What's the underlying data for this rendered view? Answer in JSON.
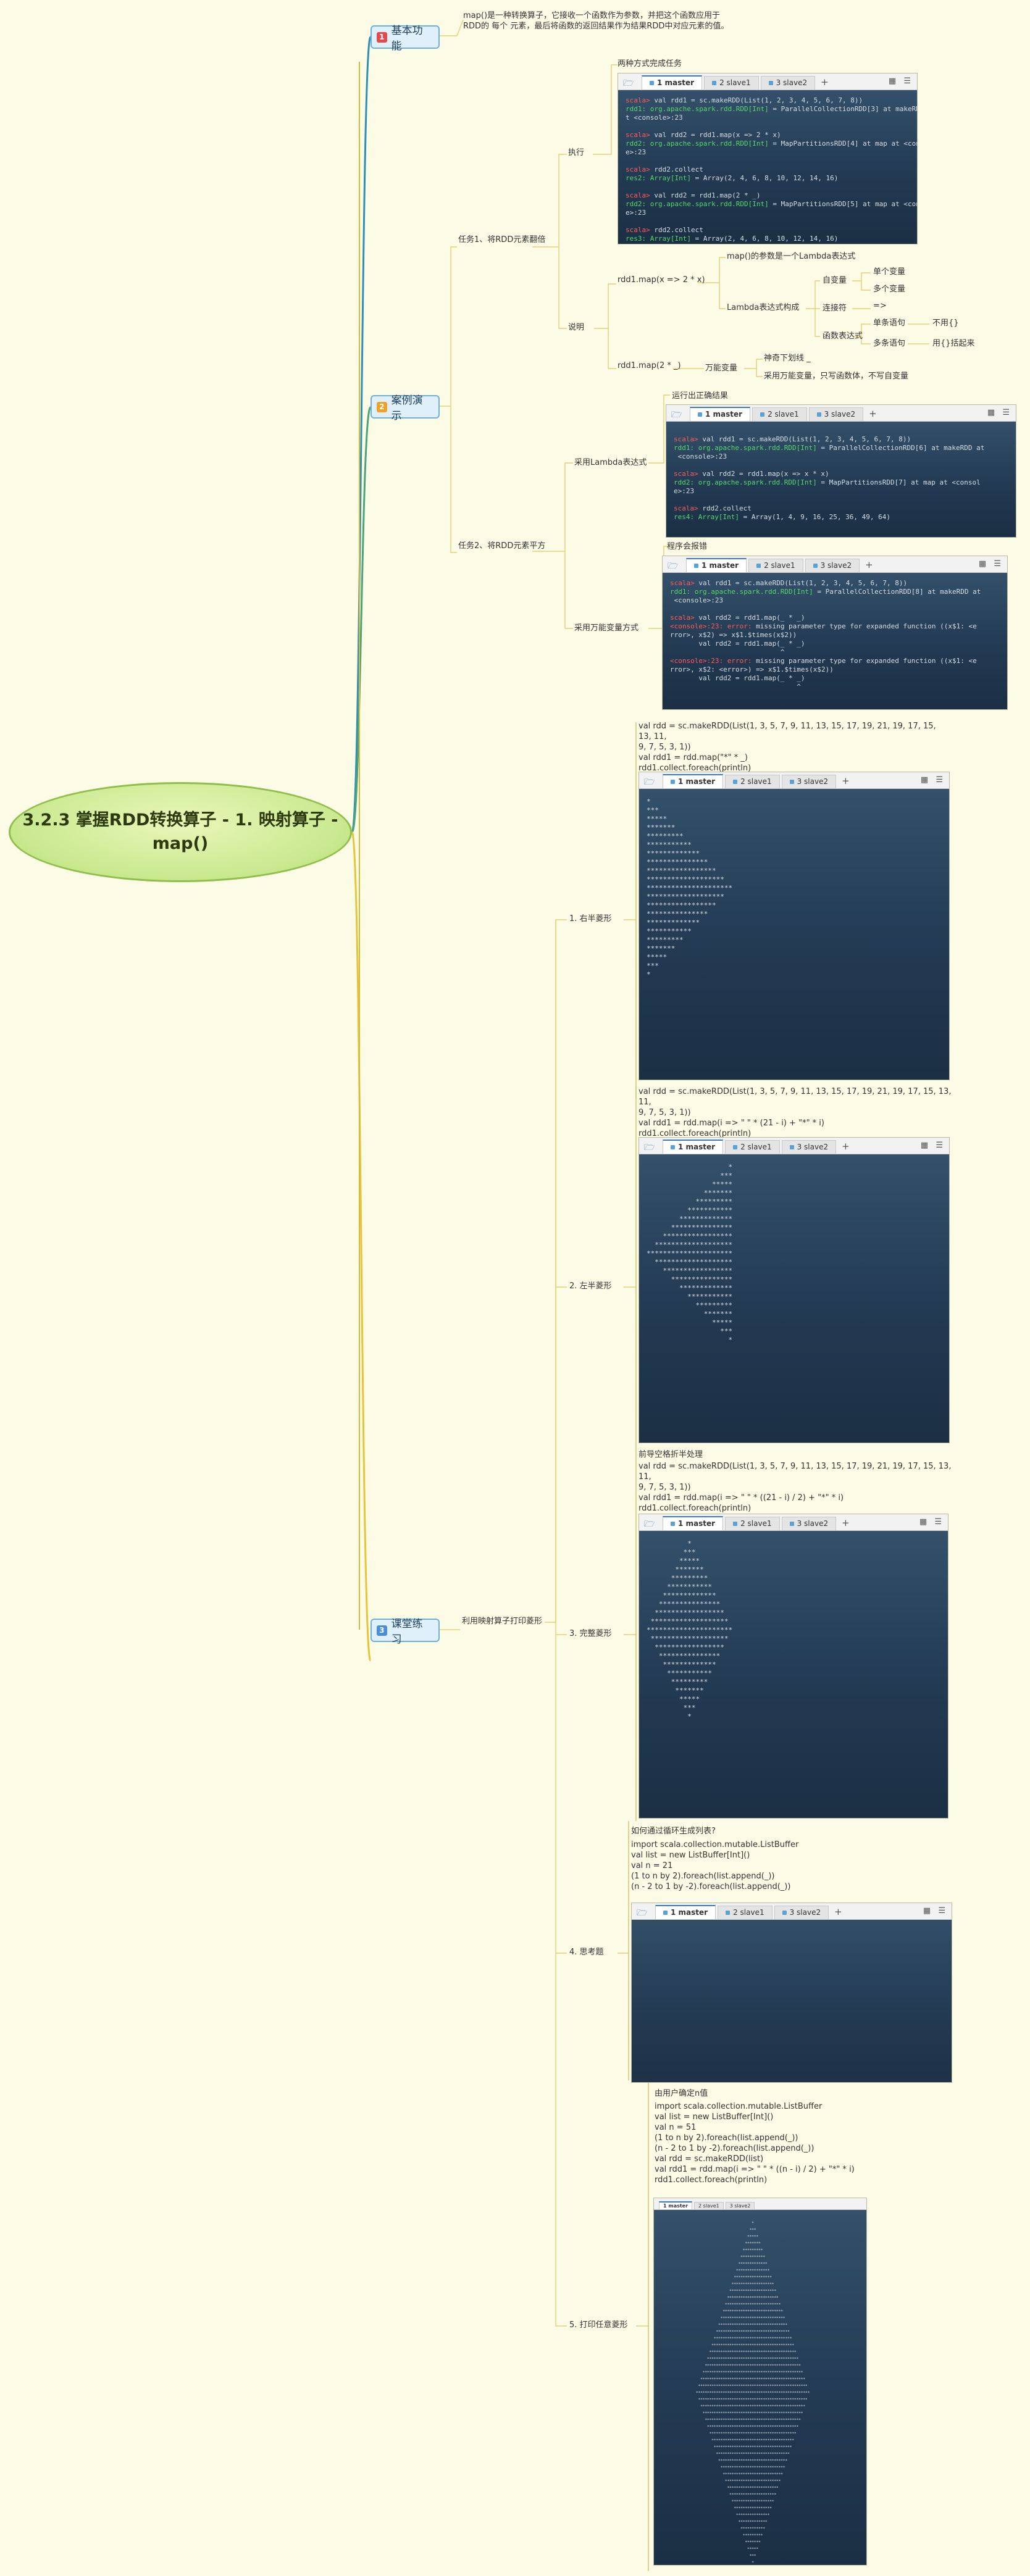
{
  "root": {
    "title": "3.2.3 掌握RDD转换算子 - 1. 映射算子 -\nmap()"
  },
  "branches": {
    "basic": {
      "num": "1",
      "label": "基本功能",
      "color": "#e24b4b"
    },
    "demo": {
      "num": "2",
      "label": "案例演示",
      "color": "#f0a12a"
    },
    "practice": {
      "num": "3",
      "label": "课堂练习",
      "color": "#4a90d9"
    }
  },
  "basic": {
    "note": "map()是一种转换算子，它接收一个函数作为参数，并把这个函数应用于\nRDD的 每个 元素，最后将函数的返回结果作为结果RDD中对应元素的值。"
  },
  "task1": {
    "label": "任务1、将RDD元素翻倍",
    "exec": "执行",
    "exec_title": "两种方式完成任务",
    "explain": "说明",
    "ex1": "rdd1.map(x => 2 * x)",
    "ex1_note": "map()的参数是一个Lambda表达式",
    "lambda_label": "Lambda表达式构成",
    "free_var": "自变量",
    "single_var": "单个变量",
    "multi_var": "多个变量",
    "connector": "连接符",
    "arrow": "=>",
    "expression": "函数表达式",
    "single_stmt": "单条语句",
    "no_brace": "不用{}",
    "multi_stmt": "多条语句",
    "use_brace": "用{}括起来",
    "ex2": "rdd1.map(2 * _)",
    "wildcard": "万能变量",
    "wild_note1": "神奇下划线 _",
    "wild_note2": "采用万能变量，只写函数体，不写自变量"
  },
  "task2": {
    "label": "任务2、将RDD元素平方",
    "way1": "采用Lambda表达式",
    "way1_note": "运行出正确结果",
    "way2": "采用万能变量方式",
    "way2_note": "程序会报错"
  },
  "practice": {
    "label": "利用映射算子打印菱形",
    "item1": "1. 右半菱形",
    "item1_code": "val rdd = sc.makeRDD(List(1, 3, 5, 7, 9, 11, 13, 15, 17, 19, 21, 19, 17, 15, 13, 11,\n9, 7, 5, 3, 1))\nval rdd1 = rdd.map(\"*\" * _)\nrdd1.collect.foreach(println)",
    "item2": "2. 左半菱形",
    "item2_code": "val rdd = sc.makeRDD(List(1, 3, 5, 7, 9, 11, 13, 15, 17, 19, 21, 19, 17, 15, 13, 11,\n9, 7, 5, 3, 1))\nval rdd1 = rdd.map(i => \" \" * (21 - i) + \"*\" * i)\nrdd1.collect.foreach(println)",
    "item3": "3. 完整菱形",
    "item3_pre": "前导空格折半处理",
    "item3_code": "val rdd = sc.makeRDD(List(1, 3, 5, 7, 9, 11, 13, 15, 17, 19, 21, 19, 17, 15, 13, 11,\n9, 7, 5, 3, 1))\nval rdd1 = rdd.map(i => \" \" * ((21 - i) / 2) + \"*\" * i)\nrdd1.collect.foreach(println)",
    "item4": "4. 思考题",
    "item4_pre": "如何通过循环生成列表?",
    "item4_code": "import scala.collection.mutable.ListBuffer\nval list = new ListBuffer[Int]()\nval n = 21\n(1 to n by 2).foreach(list.append(_))\n(n - 2 to 1 by -2).foreach(list.append(_))",
    "item5": "5. 打印任意菱形",
    "item5_pre": "由用户确定n值",
    "item5_code": "import scala.collection.mutable.ListBuffer\nval list = new ListBuffer[Int]()\nval n = 51\n(1 to n by 2).foreach(list.append(_))\n(n - 2 to 1 by -2).foreach(list.append(_))\nval rdd = sc.makeRDD(list)\nval rdd1 = rdd.map(i => \" \" * ((n - i) / 2) + \"*\" * i)\nrdd1.collect.foreach(println)"
  },
  "terminal": {
    "tab1": "1 master",
    "tab2": "2 slave1",
    "tab3": "3 slave2",
    "plus": "+",
    "grid": "▦ ☰"
  },
  "screens": {
    "s1": [
      [
        [
          "p",
          "scala> "
        ],
        [
          "",
          "val rdd1 = sc.makeRDD(List(1, 2, 3, 4, 5, 6, 7, 8))"
        ]
      ],
      [
        [
          "g",
          "rdd1: org.apache.spark.rdd.RDD[Int]"
        ],
        [
          "",
          " = ParallelCollectionRDD[3] at makeRDD a"
        ]
      ],
      [
        [
          "",
          "t <console>:23"
        ]
      ],
      [
        [
          "",
          ""
        ]
      ],
      [
        [
          "p",
          "scala> "
        ],
        [
          "",
          "val rdd2 = rdd1.map(x => 2 * x)"
        ]
      ],
      [
        [
          "g",
          "rdd2: org.apache.spark.rdd.RDD[Int]"
        ],
        [
          "",
          " = MapPartitionsRDD[4] at map at <consol"
        ]
      ],
      [
        [
          "",
          "e>:23"
        ]
      ],
      [
        [
          "",
          ""
        ]
      ],
      [
        [
          "p",
          "scala> "
        ],
        [
          "",
          "rdd2.collect"
        ]
      ],
      [
        [
          "g",
          "res2: Array[Int]"
        ],
        [
          "",
          " = Array(2, 4, 6, 8, 10, 12, 14, 16)"
        ]
      ],
      [
        [
          "",
          ""
        ]
      ],
      [
        [
          "p",
          "scala> "
        ],
        [
          "",
          "val rdd2 = rdd1.map(2 * _)"
        ]
      ],
      [
        [
          "g",
          "rdd2: org.apache.spark.rdd.RDD[Int]"
        ],
        [
          "",
          " = MapPartitionsRDD[5] at map at <consol"
        ]
      ],
      [
        [
          "",
          "e>:23"
        ]
      ],
      [
        [
          "",
          ""
        ]
      ],
      [
        [
          "p",
          "scala> "
        ],
        [
          "",
          "rdd2.collect"
        ]
      ],
      [
        [
          "g",
          "res3: Array[Int]"
        ],
        [
          "",
          " = Array(2, 4, 6, 8, 10, 12, 14, 16)"
        ]
      ]
    ],
    "s2": [
      [
        [
          "p",
          "scala> "
        ],
        [
          "",
          "val rdd1 = sc.makeRDD(List(1, 2, 3, 4, 5, 6, 7, 8))"
        ]
      ],
      [
        [
          "g",
          "rdd1: org.apache.spark.rdd.RDD[Int]"
        ],
        [
          "",
          " = ParallelCollectionRDD[6] at makeRDD at"
        ]
      ],
      [
        [
          "",
          "",
          " <console>:23"
        ]
      ],
      [
        [
          "",
          ""
        ]
      ],
      [
        [
          "p",
          "scala> "
        ],
        [
          "",
          "val rdd2 = rdd1.map(x => x * x)"
        ]
      ],
      [
        [
          "g",
          "rdd2: org.apache.spark.rdd.RDD[Int]"
        ],
        [
          "",
          " = MapPartitionsRDD[7] at map at <consol"
        ]
      ],
      [
        [
          "",
          "e>:23"
        ]
      ],
      [
        [
          "",
          ""
        ]
      ],
      [
        [
          "p",
          "scala> "
        ],
        [
          "",
          "rdd2.collect"
        ]
      ],
      [
        [
          "g",
          "res4: Array[Int]"
        ],
        [
          "",
          " = Array(1, 4, 9, 16, 25, 36, 49, 64)"
        ]
      ]
    ],
    "s3": [
      [
        [
          "p",
          "scala> "
        ],
        [
          "",
          "val rdd1 = sc.makeRDD(List(1, 2, 3, 4, 5, 6, 7, 8))"
        ]
      ],
      [
        [
          "g",
          "rdd1: org.apache.spark.rdd.RDD[Int]"
        ],
        [
          "",
          " = ParallelCollectionRDD[8] at makeRDD at"
        ]
      ],
      [
        [
          "",
          " <console>:23"
        ]
      ],
      [
        [
          "",
          ""
        ]
      ],
      [
        [
          "p",
          "scala> "
        ],
        [
          "",
          "val rdd2 = rdd1.map(_ * _)"
        ]
      ],
      [
        [
          "p",
          "<console>:23: error: "
        ],
        [
          "",
          "missing parameter type for expanded function ((x$1: <e"
        ]
      ],
      [
        [
          "",
          "rror>, x$2) => x$1.$times(x$2))"
        ]
      ],
      [
        [
          "",
          "       val rdd2 = rdd1.map(_ * _)"
        ]
      ],
      [
        [
          "",
          "                           ^"
        ]
      ],
      [
        [
          "p",
          "<console>:23: error: "
        ],
        [
          "",
          "missing parameter type for expanded function ((x$1: <e"
        ]
      ],
      [
        [
          "",
          "rror>, x$2: <error>) => x$1.$times(x$2))"
        ]
      ],
      [
        [
          "",
          "       val rdd2 = rdd1.map(_ * _)"
        ]
      ],
      [
        [
          "",
          "                               ^"
        ]
      ]
    ]
  }
}
